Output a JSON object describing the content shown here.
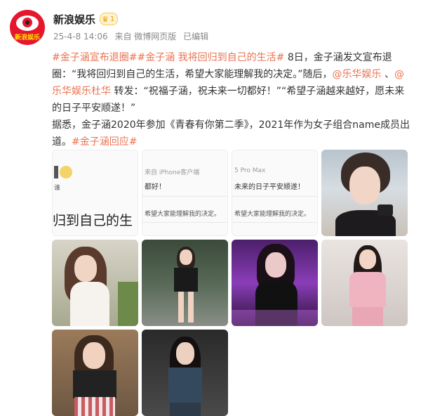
{
  "header": {
    "avatar_text": "新浪娱乐",
    "author": "新浪娱乐",
    "vip_level": "1",
    "date": "25-4-8 14:06",
    "source": "来自 微博网页版",
    "edited": "已编辑"
  },
  "post": {
    "tag1": "#金子涵宣布退圈#",
    "tag2": "#金子涵 我将回归到自己的生活#",
    "p1": " 8日，金子涵发文宣布退圈：“我将回归到自己的生活，希望大家能理解我的决定。”随后，",
    "mention1": "@乐华娱乐",
    "sep": " 、",
    "mention2": "@乐华娱乐杜华",
    "p2": " 转发：“祝福子涵，祝未来一切都好！”“希望子涵越来越好，愿未来的日子平安顺遂！”",
    "p3": "据悉，金子涵2020年参加《青春有你第二季》，2021年作为女子组合name成员出道。",
    "tag3": "#金子涵回应#"
  },
  "images": {
    "s1_big": "归到自己的生",
    "s1_small": "谁",
    "s2_source": "来自 iPhone客户端",
    "s2_line1": "都好！",
    "s2_line2": "希望大家能理解我的决定。",
    "s3_source": "5 Pro Max",
    "s3_line1": "未来的日子平安顺遂！",
    "s3_line2": "希望大家能理解我的决定。"
  },
  "colors": {
    "link": "#eb7350",
    "brand_red": "#e6162d"
  }
}
